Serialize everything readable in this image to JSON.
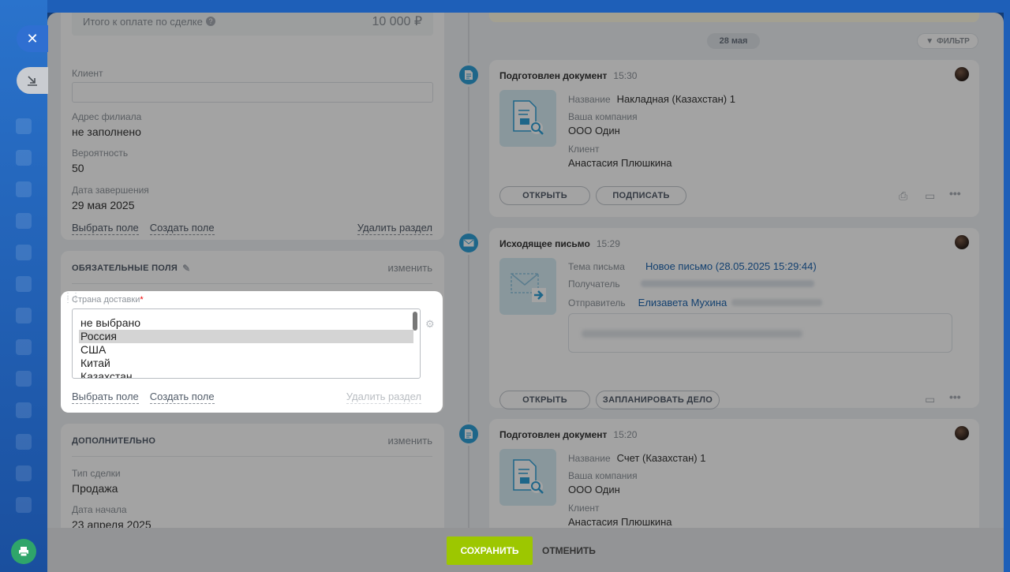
{
  "left": {
    "total_label": "Итого к оплате по сделке",
    "total_value": "10 000 ₽",
    "fields": [
      {
        "label": "Клиент",
        "value": ""
      },
      {
        "label": "Адрес филиала",
        "value": "не заполнено"
      },
      {
        "label": "Вероятность",
        "value": "50"
      },
      {
        "label": "Дата завершения",
        "value": "29 мая 2025"
      }
    ],
    "select_field": "Выбрать поле",
    "create_field": "Создать поле",
    "delete_section": "Удалить раздел",
    "required_section": {
      "title": "ОБЯЗАТЕЛЬНЫЕ ПОЛЯ",
      "edit": "изменить"
    },
    "delivery": {
      "label": "Страна доставки",
      "required_mark": "*",
      "options": [
        "не выбрано",
        "Россия",
        "США",
        "Китай",
        "Казахстан"
      ],
      "selected": "Россия"
    },
    "additional_section": {
      "title": "ДОПОЛНИТЕЛЬНО",
      "edit": "изменить",
      "fields": [
        {
          "label": "Тип сделки",
          "value": "Продажа"
        },
        {
          "label": "Дата начала",
          "value": "23 апреля 2025"
        }
      ]
    }
  },
  "timeline": {
    "date_chip": "28 мая",
    "filter": "ФИЛЬТР",
    "items": [
      {
        "title": "Подготовлен документ",
        "time": "15:30",
        "rows": [
          {
            "label": "Название",
            "value": "Накладная (Казахстан) 1"
          },
          {
            "label": "Ваша компания",
            "value": "ООО Один"
          },
          {
            "label": "Клиент",
            "value": "Анастасия Плюшкина"
          }
        ],
        "buttons": [
          "ОТКРЫТЬ",
          "ПОДПИСАТЬ"
        ]
      },
      {
        "title": "Исходящее письмо",
        "time": "15:29",
        "rows": [
          {
            "label": "Тема письма",
            "value": "Новое письмо (28.05.2025 15:29:44)"
          },
          {
            "label": "Получатель",
            "value": ""
          },
          {
            "label": "Отправитель",
            "value": "Елизавета Мухина"
          }
        ],
        "buttons": [
          "ОТКРЫТЬ",
          "ЗАПЛАНИРОВАТЬ ДЕЛО"
        ]
      },
      {
        "title": "Подготовлен документ",
        "time": "15:20",
        "rows": [
          {
            "label": "Название",
            "value": "Счет (Казахстан) 1"
          },
          {
            "label": "Ваша компания",
            "value": "ООО Один"
          },
          {
            "label": "Клиент",
            "value": "Анастасия Плюшкина"
          }
        ]
      }
    ]
  },
  "footer": {
    "save": "СОХРАНИТЬ",
    "cancel": "ОТМЕНИТЬ"
  },
  "colors": {
    "accent": "#2fa0d6",
    "save": "#9dc700",
    "link": "#2067b0",
    "required": "#e00"
  }
}
